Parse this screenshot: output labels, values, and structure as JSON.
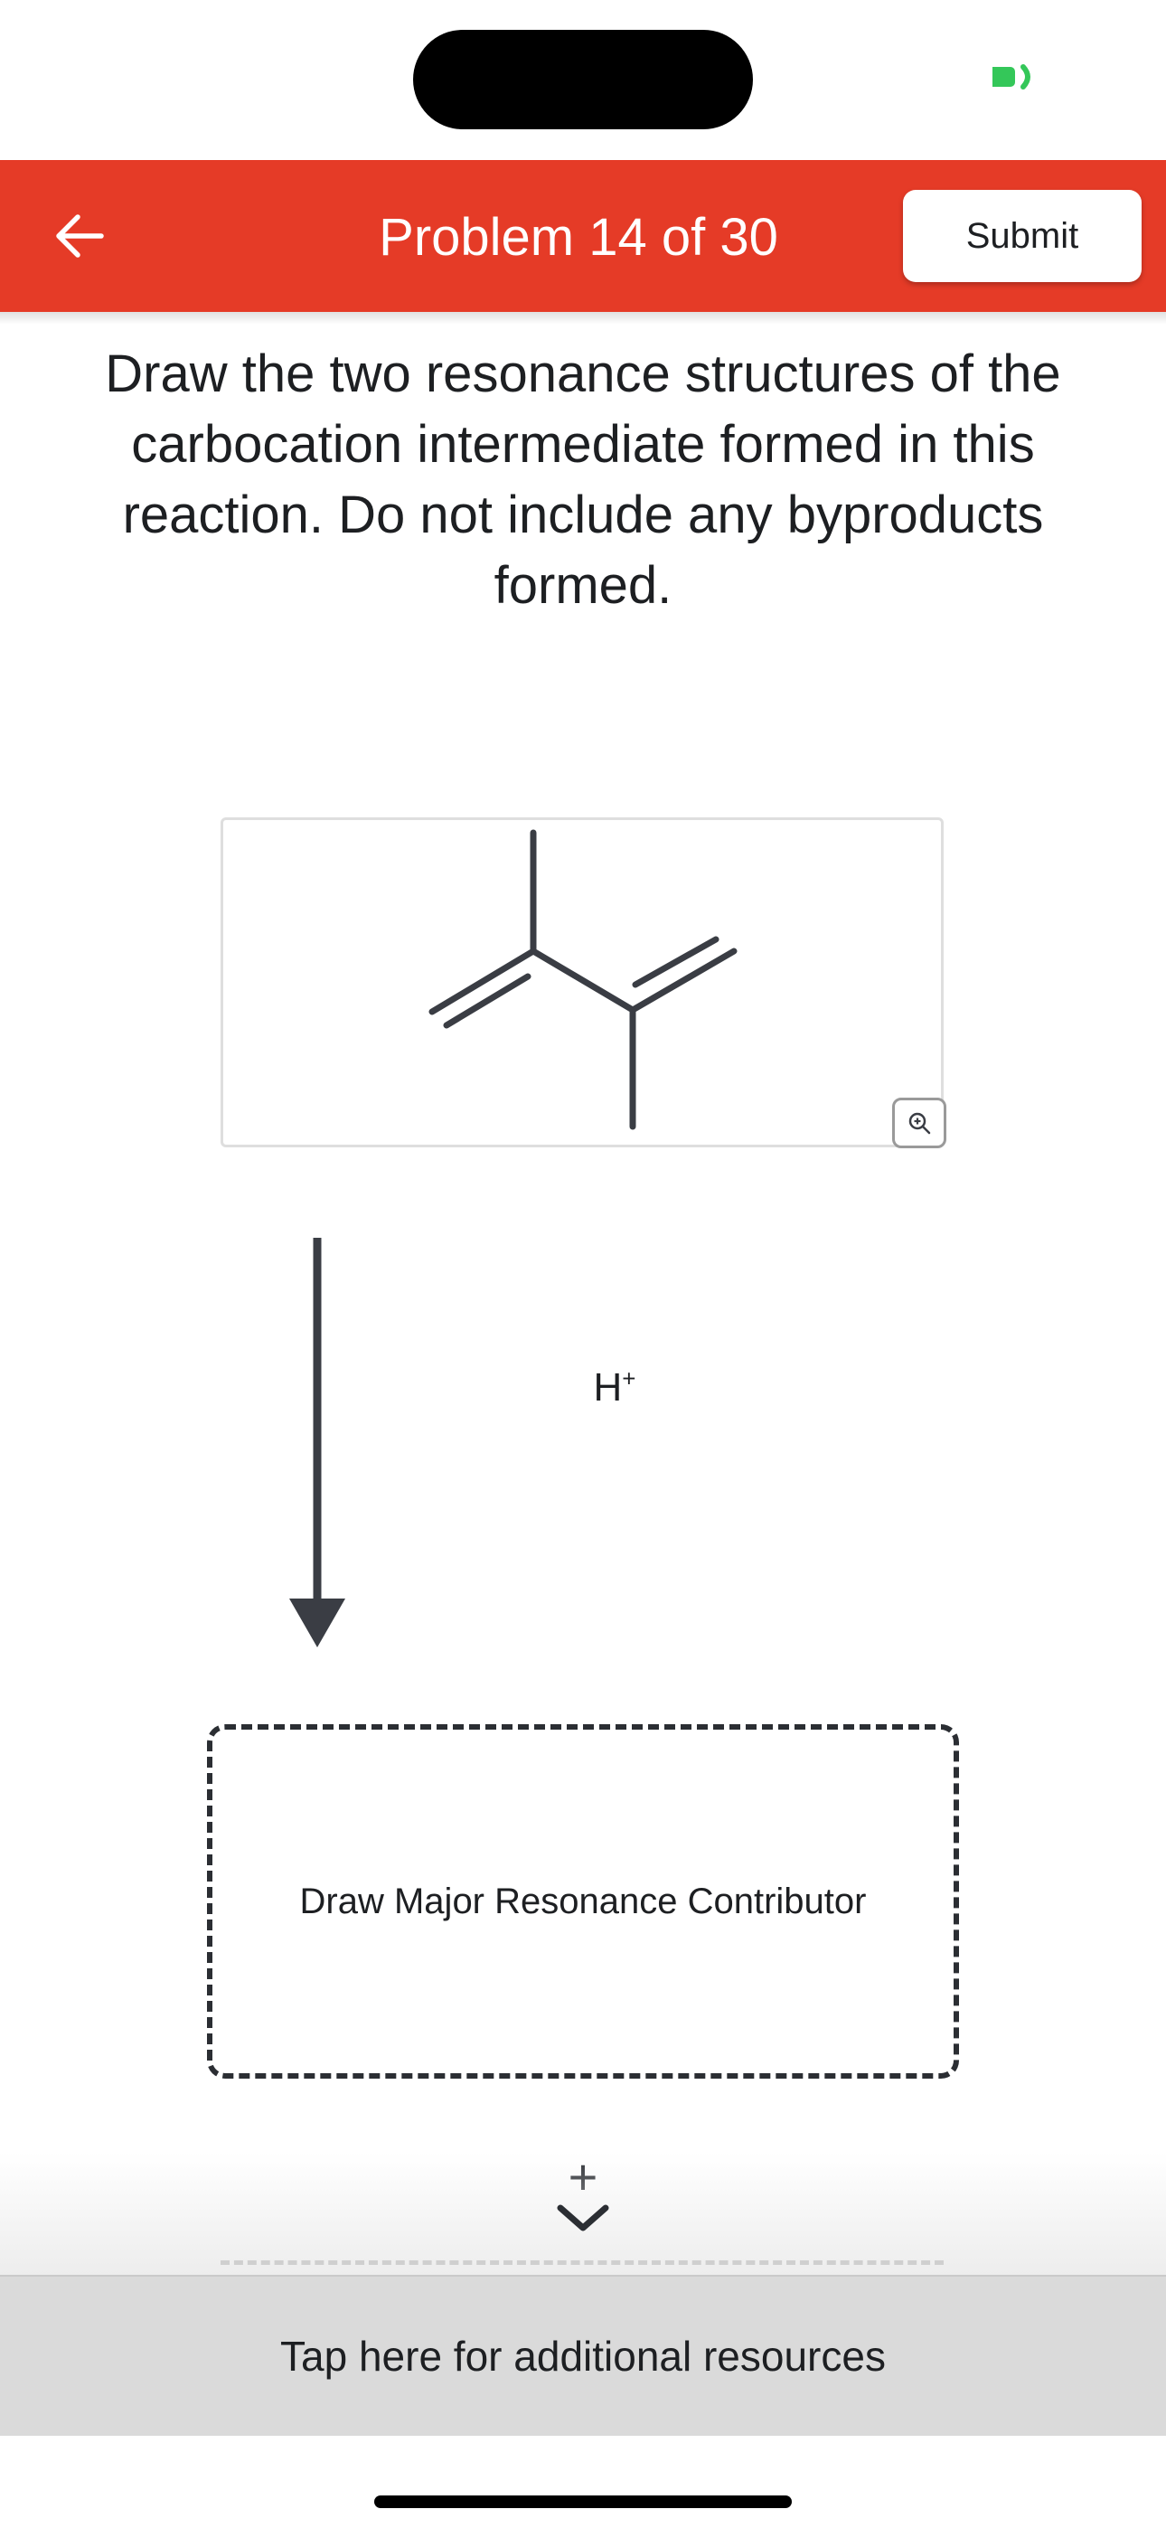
{
  "status_bar": {
    "indicator_color": "#34c759"
  },
  "header": {
    "back_icon": "arrow-left-icon",
    "title": "Problem 14 of 30",
    "submit_label": "Submit",
    "background_color": "#e53b27"
  },
  "question": {
    "text": "Draw the two resonance structures of the carbocation intermediate formed in this reaction. Do not include any byproducts formed."
  },
  "reactant": {
    "zoom_icon": "zoom-in-icon"
  },
  "reaction": {
    "reagent": "H",
    "reagent_charge": "+"
  },
  "answer_area": {
    "label": "Draw Major Resonance Contributor",
    "add_label": "+",
    "expand_icon": "chevron-down-icon"
  },
  "resources": {
    "label": "Tap here for additional resources"
  }
}
